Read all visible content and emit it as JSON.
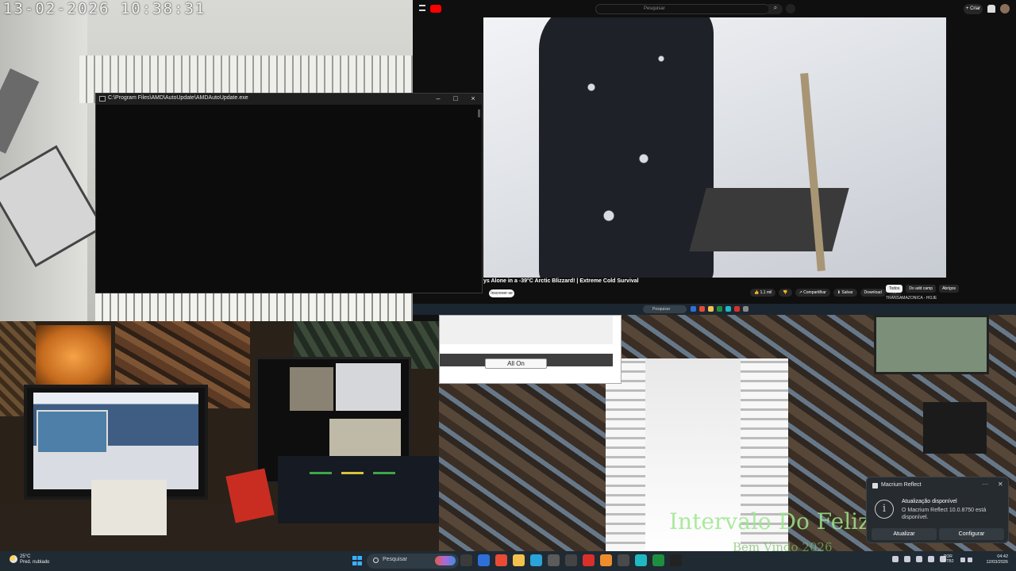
{
  "cam_top_left": {
    "timestamp": "13-02-2026  10:38:31"
  },
  "cmd_window": {
    "title": "C:\\Program Files\\AMD\\AutoUpdate\\AMDAutoUpdate.exe",
    "minimize": "–",
    "maximize": "□",
    "close": "×"
  },
  "youtube": {
    "search_placeholder": "Pesquisar",
    "search_btn": "⌕",
    "create_label": "+ Criar",
    "video_title": "ys Alone in a -39°C Arctic Blizzard! | Extreme Cold Survival",
    "subscribe_label": "Inscrever-se",
    "actions": [
      "👍 1,1 mil",
      "👎",
      "↗ Compartilhar",
      "⬇ Salvar",
      "Download",
      "…"
    ],
    "chips": [
      "Todos",
      "Do add camp",
      "Abrigos"
    ],
    "live_row": "TRANSAMAZONICA - HOJE"
  },
  "mini_taskbar": {
    "search": "Pesquisar"
  },
  "amd_fragment": {
    "button": "All On"
  },
  "cam_bottom_right": {
    "overlay": "Intervalo Do Feliz",
    "overlay2": "Bem Vindo 2026"
  },
  "toast": {
    "app_name": "Macrium Reflect",
    "more": "···",
    "close": "✕",
    "info_glyph": "i",
    "heading": "Atualização disponível",
    "body": "O Macrium Reflect 10.0.8750 está disponível.",
    "button_update": "Atualizar",
    "button_configure": "Configurar"
  },
  "taskbar": {
    "weather_temp": "25°C",
    "weather_desc": "Pred. nublado",
    "search_placeholder": "Pesquisar",
    "lang_line1": "POR",
    "lang_line2": "PTB2",
    "time": "04:42",
    "date": "12/03/2026",
    "app_colors": [
      "#3b3b3b",
      "#2f6fd6",
      "#e94b35",
      "#f2c14e",
      "#2aa3d8",
      "#5b5b5b",
      "#444",
      "#d9302c",
      "#f08c2b",
      "#4a4a4a",
      "#20b9c2",
      "#1e8f3f",
      "#222"
    ]
  }
}
